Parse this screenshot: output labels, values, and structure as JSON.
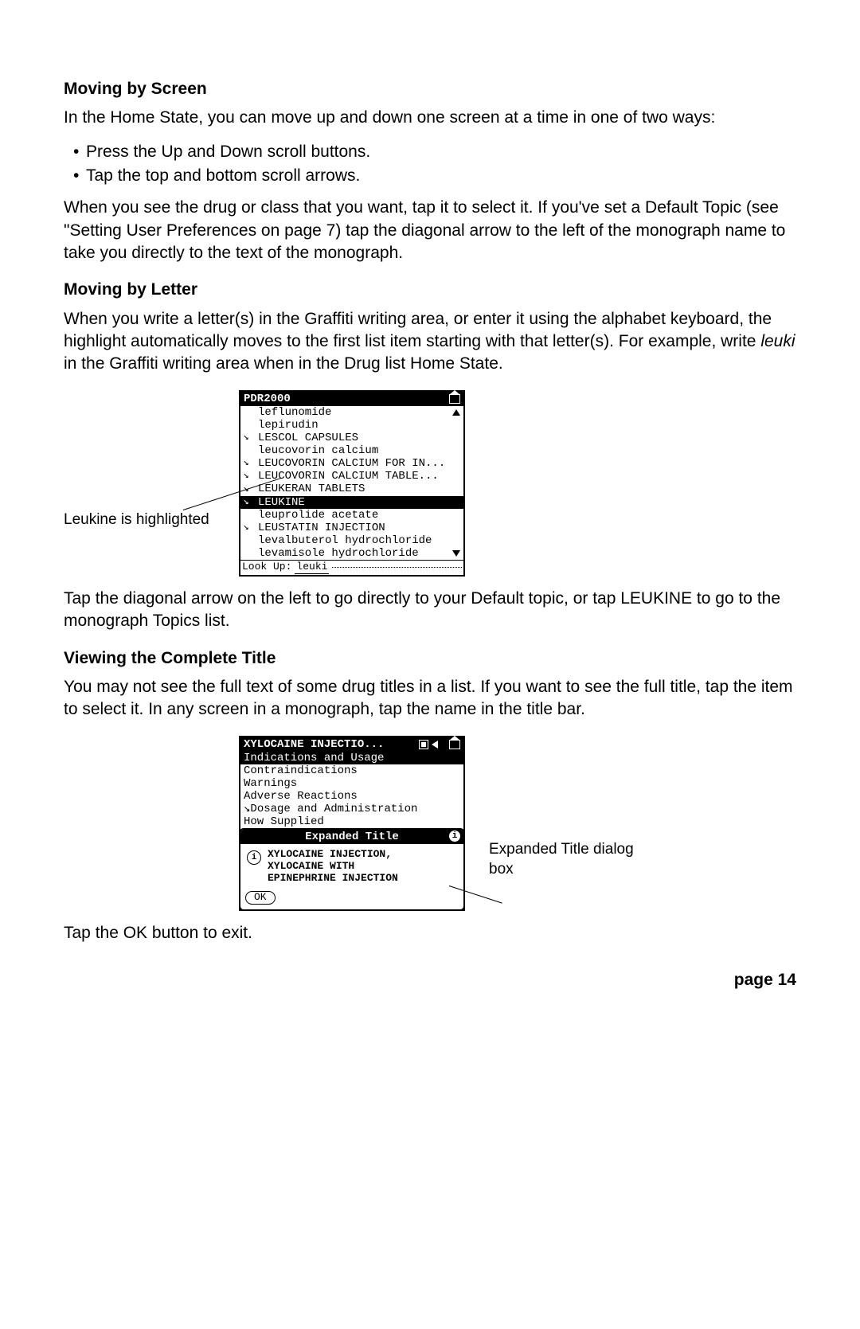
{
  "sec1": {
    "heading": "Moving by Screen",
    "p1": "In the Home State, you can move up and down one screen at a time in one of two ways:",
    "b1": "Press the Up and Down scroll buttons.",
    "b2": "Tap the top and bottom scroll arrows.",
    "p2": "When you see the drug or class that you want, tap it to select it. If you've set a Default Topic (see \"Setting User Preferences on page 7) tap the diagonal arrow to the left of the monograph name to take you directly to the text of the monograph."
  },
  "sec2": {
    "heading": "Moving by Letter",
    "p1a": "When you write a letter(s) in the Graffiti writing area, or enter it using the alphabet keyboard, the highlight automatically moves to the first list item starting with that letter(s). For example, write ",
    "p1_em": "leuki",
    "p1b": " in the Graffiti writing area when in the Drug list Home State.",
    "callout": "Leukine is highlighted",
    "palm": {
      "title": "PDR2000",
      "items": [
        {
          "diag": false,
          "text": "leflunomide"
        },
        {
          "diag": false,
          "text": "lepirudin"
        },
        {
          "diag": true,
          "text": "LESCOL CAPSULES"
        },
        {
          "diag": false,
          "text": "leucovorin calcium"
        },
        {
          "diag": true,
          "text": "LEUCOVORIN CALCIUM FOR IN..."
        },
        {
          "diag": true,
          "text": "LEUCOVORIN CALCIUM TABLE..."
        },
        {
          "diag": true,
          "text": "LEUKERAN TABLETS"
        },
        {
          "diag": true,
          "text": "LEUKINE",
          "sel": true
        },
        {
          "diag": false,
          "text": "leuprolide acetate"
        },
        {
          "diag": true,
          "text": "LEUSTATIN INJECTION"
        },
        {
          "diag": false,
          "text": "levalbuterol hydrochloride"
        },
        {
          "diag": false,
          "text": "levamisole hydrochloride"
        }
      ],
      "lookup_label": "Look Up:",
      "lookup_value": "leuki"
    },
    "p2": "Tap the diagonal arrow on the left to go directly to your Default topic, or tap LEUKINE to go to the monograph Topics list."
  },
  "sec3": {
    "heading": "Viewing the Complete Title",
    "p1": "You may not see the full text of some drug titles in a list. If you want to see the full title, tap the item to select it. In any screen in a monograph, tap the name in the title bar.",
    "palm": {
      "title": "XYLOCAINE INJECTIO...",
      "rows": [
        {
          "text": "Indications and Usage",
          "sel": true
        },
        {
          "text": "Contraindications"
        },
        {
          "text": "Warnings"
        },
        {
          "text": "Adverse Reactions"
        },
        {
          "text": "Dosage and Administration",
          "diag": true
        },
        {
          "text": "How Supplied"
        }
      ],
      "dialog_title": "Expanded Title",
      "dialog_body1": "XYLOCAINE INJECTION,",
      "dialog_body2": "XYLOCAINE WITH",
      "dialog_body3": "EPINEPHRINE INJECTION",
      "ok": "OK"
    },
    "callout": "Expanded Title dialog box",
    "p2": "Tap the OK button to exit."
  },
  "page": "page 14"
}
